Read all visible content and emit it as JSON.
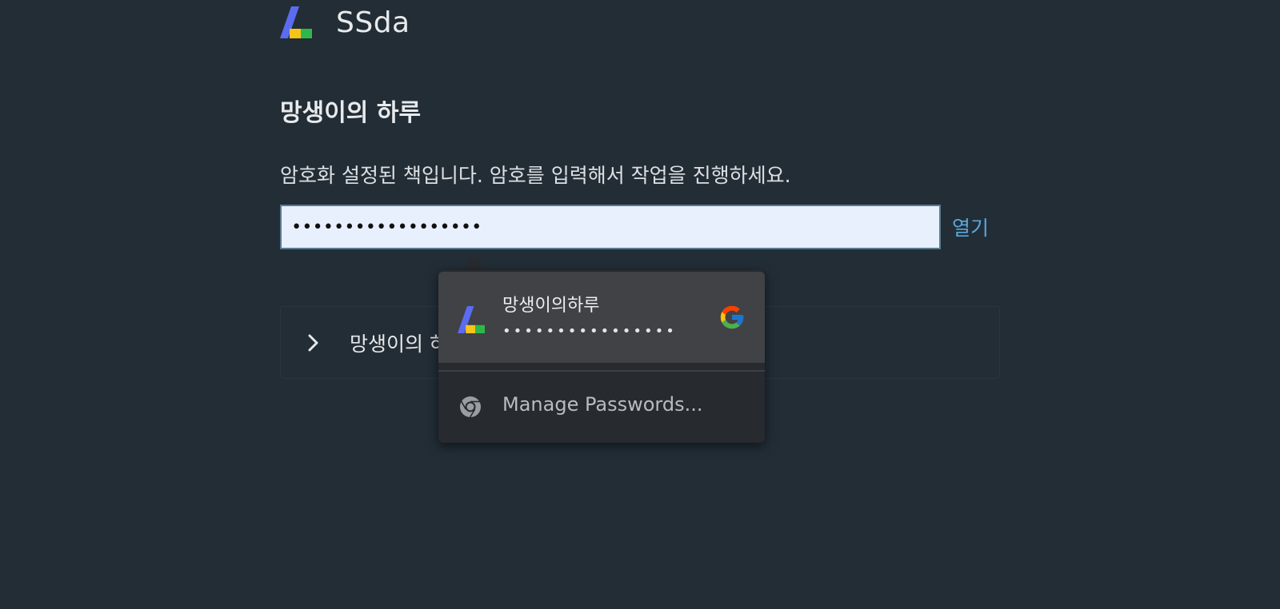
{
  "brand": {
    "name": "SSda",
    "logo_colors": [
      "#5b6cf0",
      "#f5c518",
      "#2fb84a"
    ]
  },
  "book": {
    "title": "망생이의 하루"
  },
  "unlock": {
    "instruction": "암호화 설정된 책입니다. 암호를 입력해서 작업을 진행하세요.",
    "password_value": "••••••••••••••••••",
    "open_label": "열기"
  },
  "collapse": {
    "label": "망생이의 하"
  },
  "autofill_popup": {
    "entry_site": "망생이의하루",
    "entry_password_dots": "••••••••••••••••",
    "manage_label": "Manage Passwords..."
  },
  "colors": {
    "background": "#222d36",
    "link": "#5aa7dc",
    "input_bg": "#e8f0fe",
    "popup_bg": "#272a2f",
    "popup_entry_bg": "#404245"
  }
}
